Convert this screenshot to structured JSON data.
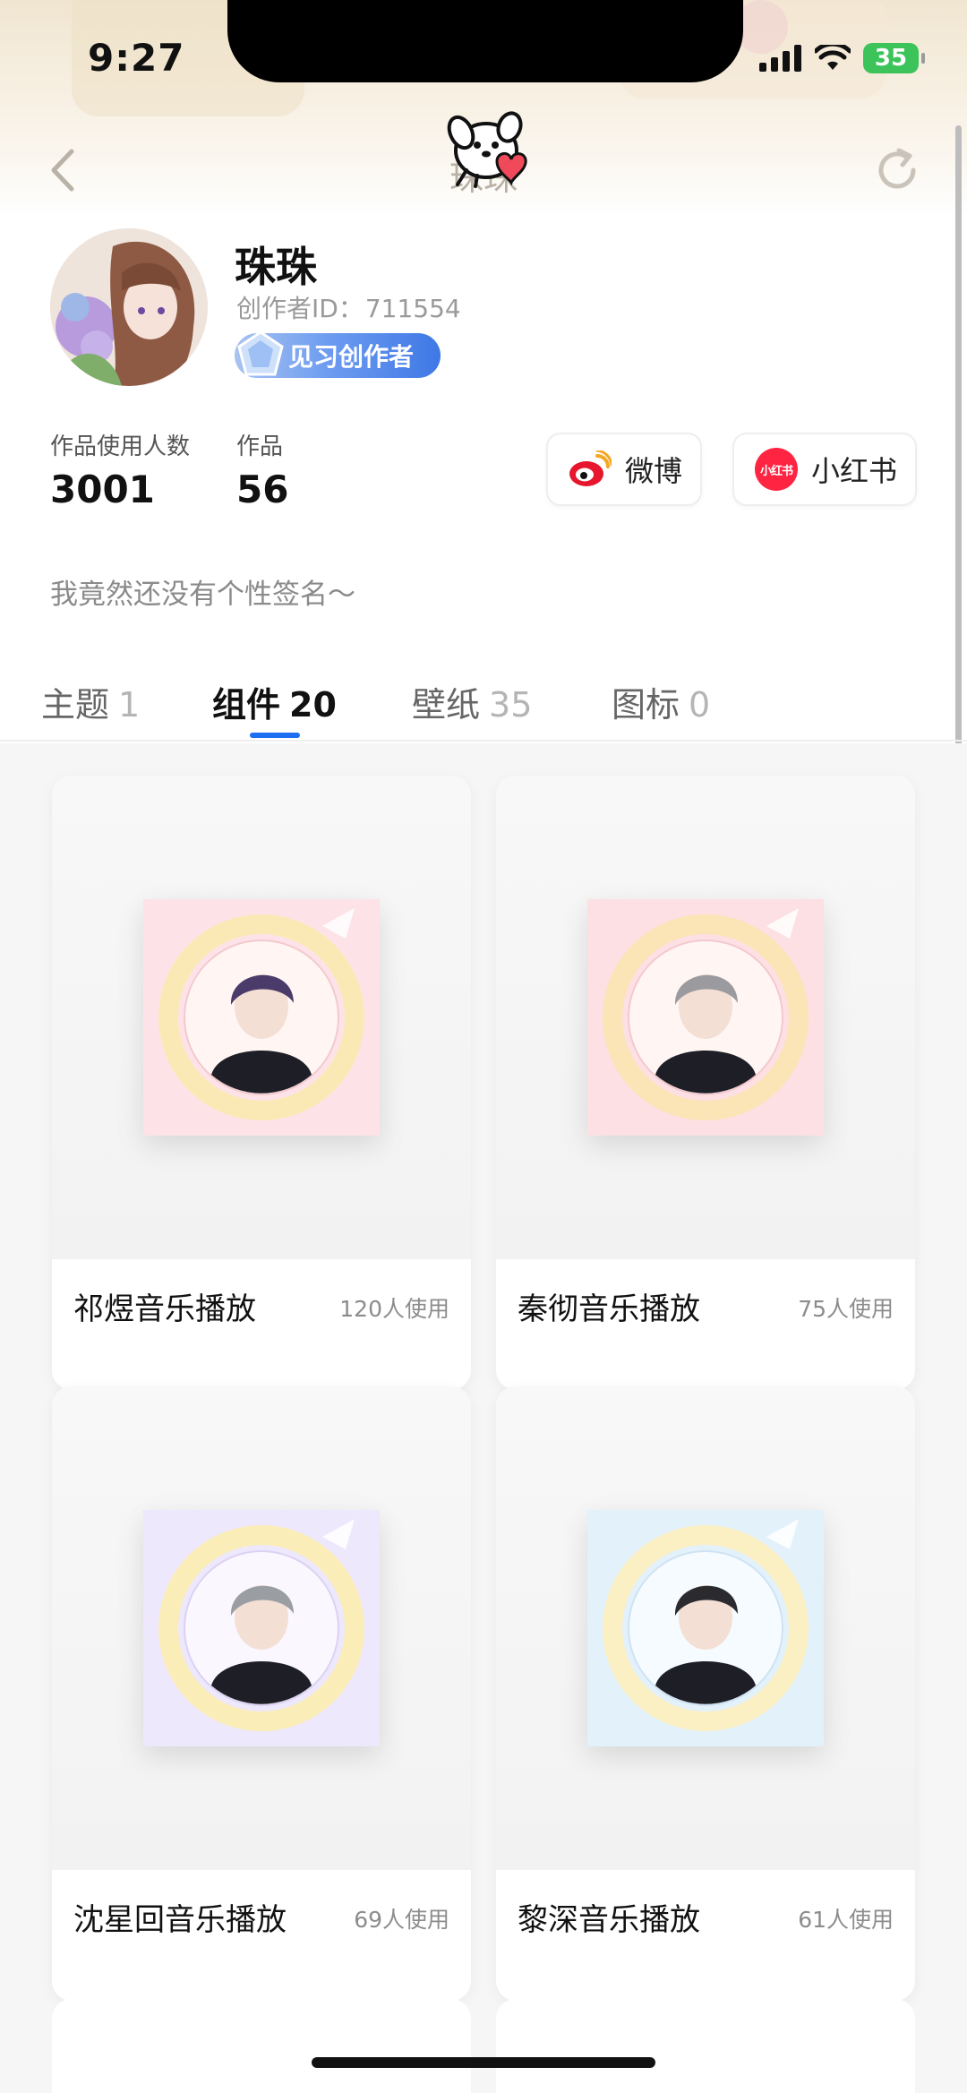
{
  "status_bar": {
    "time": "9:27",
    "battery": "35"
  },
  "nav": {
    "title": "珠珠",
    "back_icon": "chevron-left-icon",
    "refresh_icon": "refresh-icon"
  },
  "profile": {
    "name": "珠珠",
    "creator_id_label": "创作者ID：",
    "creator_id": "711554",
    "badge": "见习创作者",
    "stats": [
      {
        "label": "作品使用人数",
        "value": "3001"
      },
      {
        "label": "作品",
        "value": "56"
      }
    ],
    "signature": "我竟然还没有个性签名～"
  },
  "social": {
    "weibo": "微博",
    "xiaohongshu": "小红书",
    "xiaohongshu_icon_text": "小红书"
  },
  "tabs": [
    {
      "label": "主题",
      "count": "1"
    },
    {
      "label": "组件",
      "count": "20"
    },
    {
      "label": "壁纸",
      "count": "35"
    },
    {
      "label": "图标",
      "count": "0"
    }
  ],
  "active_tab": "组件",
  "cards": [
    {
      "title": "祁煜音乐播放",
      "uses": "120人使用",
      "bg": "#fde3e8",
      "ring": "#fbe9b5",
      "hair": "#4b3b6b"
    },
    {
      "title": "秦彻音乐播放",
      "uses": "75人使用",
      "bg": "#fde0e3",
      "ring": "#fbe4b5",
      "hair": "#9b9b9f"
    },
    {
      "title": "沈星回音乐播放",
      "uses": "69人使用",
      "bg": "#ede8fb",
      "ring": "#fbedb8",
      "hair": "#9a9ea3"
    },
    {
      "title": "黎深音乐播放",
      "uses": "61人使用",
      "bg": "#e3f1fb",
      "ring": "#fbefc4",
      "hair": "#2b2b2f"
    }
  ],
  "colors": {
    "accent": "#1f6ff2",
    "badge_gradient_end": "#3f78e6",
    "weibo_red": "#e6162d",
    "xiaohongshu_red": "#ff2442"
  }
}
